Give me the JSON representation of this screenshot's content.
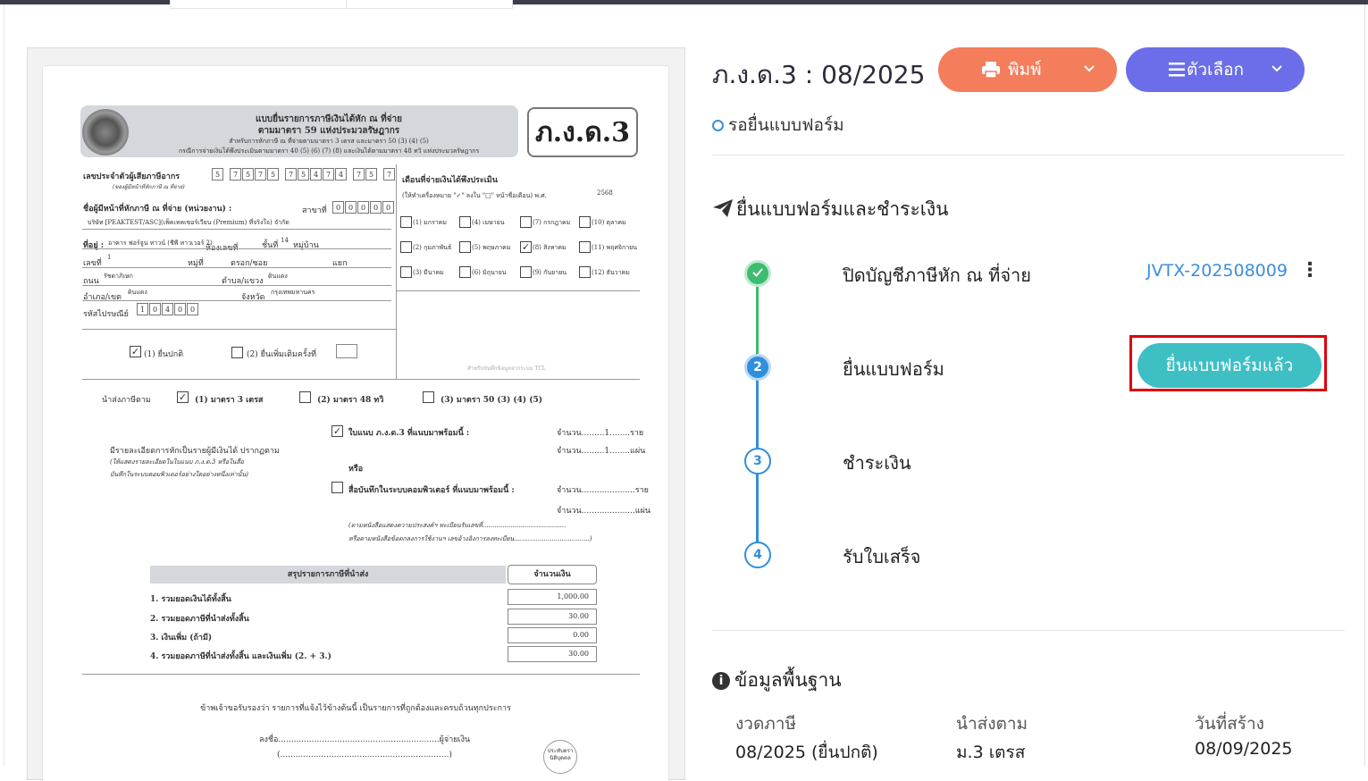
{
  "header": {
    "title": "ภ.ง.ด.3 : 08/2025",
    "print_label": "พิมพ์",
    "options_label": "ตัวเลือก",
    "print_icon": "printer-icon",
    "options_icon": "menu-icon",
    "chevron": "▾"
  },
  "status": {
    "text": "รอยื่นแบบฟอร์ม",
    "color": "#3b8ede"
  },
  "workflow": {
    "title": "ยื่นแบบฟอร์มและชำระเงิน",
    "steps": [
      {
        "number": "✓",
        "label": "ปิดบัญชีภาษีหัก ณ ที่จ่าย",
        "state": "done",
        "doc": "JVTX-202508009"
      },
      {
        "number": "2",
        "label": "ยื่นแบบฟอร์ม",
        "state": "active",
        "action": "ยื่นแบบฟอร์มแล้ว"
      },
      {
        "number": "3",
        "label": "ชำระเงิน",
        "state": "todo"
      },
      {
        "number": "4",
        "label": "รับใบเสร็จ",
        "state": "todo"
      }
    ]
  },
  "info": {
    "title": "ข้อมูลพื้นฐาน",
    "fields": [
      {
        "label": "งวดภาษี",
        "value": "08/2025 (ยื่นปกติ)"
      },
      {
        "label": "นำส่งตาม",
        "value": "ม.3 เตรส"
      },
      {
        "label": "วันที่สร้าง",
        "value": "08/09/2025"
      }
    ]
  },
  "form": {
    "tag": "ภ.ง.ด.3",
    "h1": "แบบยื่นรายการภาษีเงินได้หัก ณ ที่จ่าย",
    "h2": "ตามมาตรา 59 แห่งประมวลรัษฎากร",
    "h3": "สำหรับการหักภาษี ณ ที่จ่ายตามมาตรา 3 เตรส และมาตรา 50 (3) (4) (5)",
    "h4": "กรณีการจ่ายเงินได้พึงประเมินตามมาตรา 40 (5) (6) (7) (8) และเงินได้ตามมาตรา 48 ทวิ แห่งประมวลรัษฎากร",
    "taxid_label": "เลขประจำตัวผู้เสียภาษีอากร",
    "taxid_sub": "(ของผู้มีหน้าที่หักภาษี ณ ที่จ่าย)",
    "taxid": [
      "5",
      "7",
      "5",
      "7",
      "5",
      "7",
      "5",
      "4",
      "7",
      "4",
      "7",
      "5",
      "7"
    ],
    "payer_label": "ชื่อผู้มีหน้าที่หักภาษี ณ ที่จ่าย (หน่วยงาน) :",
    "branch_label": "สาขาที่",
    "branch": [
      "0",
      "0",
      "0",
      "0",
      "0"
    ],
    "company": "บริษัท [PEAKTEST/ASC](เพ็คเทคเซอร์เวียน (Premium) ที่จริงใจ) จำกัด",
    "addr_label": "ที่อยู่ :",
    "building": "อาคาร ฟอร์จูน ทาวน์ (ชีพี ทาวเวอร์ 2)",
    "room_label": "ห้องเลขที่",
    "floor_label": "ชั้นที่",
    "floor": "14",
    "village_label": "หมู่บ้าน",
    "no_label": "เลขที่",
    "no": "1",
    "moo_label": "หมู่ที่",
    "soi_label": "ตรอก/ซอย",
    "yaek_label": "แยก",
    "road_label": "ถนน",
    "road": "รัชดาภิเษก",
    "subdistrict_label": "ตำบล/แขวง",
    "subdistrict": "ดินแดง",
    "district_label": "อำเภอ/เขต",
    "district": "ดินแดง",
    "province_label": "จังหวัด",
    "province": "กรุงเทพมหานคร",
    "zip_label": "รหัสไปรษณีย์",
    "zip": [
      "1",
      "0",
      "4",
      "0",
      "0"
    ],
    "month_label": "เดือนที่จ่ายเงินได้พึงประเมิน",
    "month_hint": "(ให้ทำเครื่องหมาย \"✓\" ลงใน \"□\" หน้าชื่อเดือน) พ.ศ.",
    "year": "2568",
    "months": [
      "(1) มกราคม",
      "(4) เมษายน",
      "(7) กรกฎาคม",
      "(10) ตุลาคม",
      "(2) กุมภาพันธ์",
      "(5) พฤษภาคม",
      "(8) สิงหาคม",
      "(11) พฤศจิกายน",
      "(3) มีนาคม",
      "(6) มิถุนายน",
      "(9) กันยายน",
      "(12) ธันวาคม"
    ],
    "checked_month": "(8) สิงหาคม",
    "normal": "(1) ยื่นปกติ",
    "extra": "(2) ยื่นเพิ่มเติมครั้งที่",
    "officer": "สำหรับบันทึกข้อมูลจากระบบ TCL",
    "remit_label": "นำส่งภาษีตาม",
    "remit1": "(1) มาตรา 3 เตรส",
    "remit2": "(2) มาตรา 48 ทวิ",
    "remit3": "(3) มาตรา 50 (3) (4) (5)",
    "detail": "มีรายละเอียดการหักเป็นรายผู้มีเงินได้ ปรากฏตาม",
    "detail_sub1": "(ให้แสดงรายละเอียดในใบแนบ ภ.ง.ด.3 หรือในสื่อ",
    "detail_sub2": "บันทึกในระบบคอมพิวเตอร์อย่างใดอย่างหนึ่งเท่านั้น)",
    "attach": "ใบแนบ ภ.ง.ด.3 ที่แนบมาพร้อมนี้ :",
    "or": "หรือ",
    "media": "สื่อบันทึกในระบบคอมพิวเตอร์ ที่แนบมาพร้อมนี้ :",
    "qty1": "จำนวน.........1........ราย",
    "qty2": "จำนวน.........1........แผ่น",
    "qty3": "จำนวน.....................ราย",
    "qty4": "จำนวน.....................แผ่น",
    "note1": "(ตามหนังสือแสดงความประสงค์ฯ ทะเบียนรับเลขที่..........................................",
    "note2": "หรือตามหนังสือข้อตกลงการใช้งานฯ เลขอ้างอิงการลงทะเบียน......................................)",
    "sum_title": "สรุปรายการภาษีที่นำส่ง",
    "amt_title": "จำนวนเงิน",
    "rows": [
      {
        "label": "1. รวมยอดเงินได้ทั้งสิ้น",
        "amount": "1,000.00"
      },
      {
        "label": "2. รวมยอดภาษีที่นำส่งทั้งสิ้น",
        "amount": "30.00"
      },
      {
        "label": "3. เงินเพิ่ม (ถ้ามี)",
        "amount": "0.00"
      },
      {
        "label": "4. รวมยอดภาษีที่นำส่งทั้งสิ้น และเงินเพิ่ม (2. + 3.)",
        "amount": "30.00"
      }
    ],
    "certify": "ข้าพเจ้าขอรับรองว่า รายการที่แจ้งไว้ข้างต้นนี้ เป็นรายการที่ถูกต้องและครบถ้วนทุกประการ",
    "sign": "ลงชื่อ...............................................................ผู้จ่ายเงิน",
    "sign2": "(..................................................................)",
    "stamp": "ประทับตรานิติบุคคล"
  }
}
